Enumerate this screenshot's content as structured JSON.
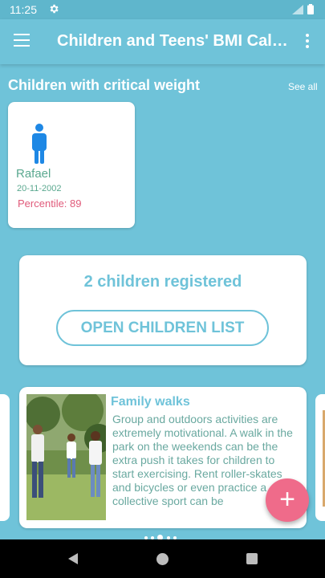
{
  "status_bar": {
    "time": "11:25",
    "icons": [
      "gear-icon",
      "signal-icon",
      "battery-icon"
    ]
  },
  "app_bar": {
    "title": "Children and Teens' BMI Calculator",
    "menu_icon": "hamburger-menu-icon",
    "more_icon": "more-vertical-icon"
  },
  "critical_section": {
    "title": "Children with critical weight",
    "see_all": "See all"
  },
  "children": [
    {
      "name": "Rafael",
      "dob": "20-11-2002",
      "percentile": "Percentile: 89",
      "icon": "child-figure-icon"
    }
  ],
  "registered": {
    "count_text": "2 children registered",
    "button_label": "OPEN CHILDREN LIST"
  },
  "tip": {
    "title": "Family walks",
    "body": "Group and outdoors activities are extremely motivational. A walk in the park on the weekends can be the extra push it takes for children to start exercising. Rent roller-skates and bicycles or even practice a collective sport can be"
  },
  "fab": {
    "label": "+"
  },
  "pager": {
    "count": 5,
    "active_index": 2
  },
  "colors": {
    "primary": "#6fc3d9",
    "accent": "#ef6b8a",
    "child_icon": "#1e88e5",
    "text_green": "#5aa88f",
    "percentile_red": "#e05a7a"
  }
}
